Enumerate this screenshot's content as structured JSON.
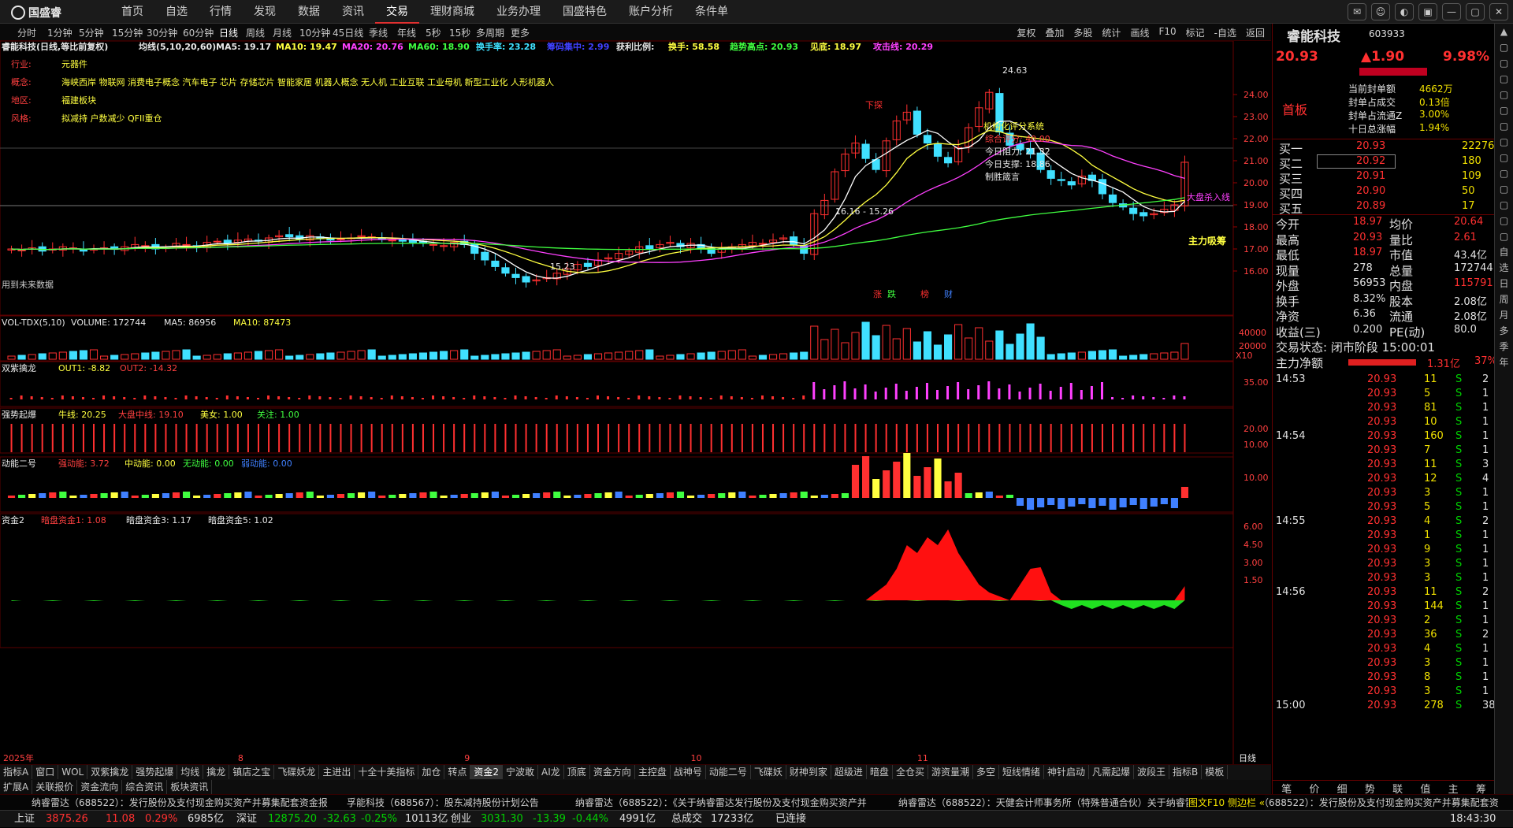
{
  "app": {
    "logo": "国盛睿"
  },
  "menu": [
    "首页",
    "自选",
    "行情",
    "发现",
    "数据",
    "资讯",
    "交易",
    "理财商城",
    "业务办理",
    "国盛特色",
    "账户分析",
    "条件单"
  ],
  "periods": [
    "分时",
    "1分钟",
    "5分钟",
    "15分钟",
    "30分钟",
    "60分钟",
    "日线",
    "周线",
    "月线",
    "10分钟",
    "45日线",
    "季线",
    "年线",
    "5秒",
    "15秒",
    "多周期",
    "更多"
  ],
  "right_tools": [
    "复权",
    "叠加",
    "多股",
    "统计",
    "画线",
    "F10",
    "标记",
    "-自选",
    "返回"
  ],
  "stock": {
    "name": "睿能科技",
    "code": "603933",
    "price": "20.93",
    "change": "▲1.90",
    "pct": "9.98%",
    "board": "首板"
  },
  "header_line": {
    "title": "睿能科技(日线,等比前复权)",
    "ma_label": "均线(5,10,20,60)",
    "ma5": "MA5: 19.17",
    "ma10": "MA10: 19.47",
    "ma20": "MA20: 20.76",
    "ma60": "MA60: 18.90",
    "turnover": "换手率: 23.28",
    "chip": "筹码集中: 2.99",
    "profit": "获利比例:",
    "hand": "换手: 58.58",
    "trend_high": "趋势高点: 20.93",
    "low": "见底: 18.97",
    "attack": "攻击线: 20.29"
  },
  "info": {
    "industry_label": "行业:",
    "industry": "元器件",
    "concept_label": "概念:",
    "concept": "海峡西岸 物联网 消费电子概念 汽车电子 芯片 存储芯片 智能家居 机器人概念 无人机 工业互联 工业母机 新型工业化 人形机器人",
    "region_label": "地区:",
    "region": "福建板块",
    "style_label": "风格:",
    "style": "拟减持 户数减少 QFII重仓"
  },
  "annotations": {
    "high": "24.63",
    "low1": "15.23",
    "lowpair": "16.16 - 15.26",
    "xiatan": "下探",
    "sys": "机构化评分系统",
    "score": "综合评分: 40.00",
    "pressure": "今日阻力: 21.32",
    "support": "今日支撑: 18.86",
    "win": "制胜箴言",
    "sell": "大盘杀入线",
    "main": "主力吸筹",
    "future": "用到未来数据",
    "zd": "涨",
    "die": "跌",
    "bang": "榜",
    "cai": "财"
  },
  "price_axis": [
    "24.00",
    "23.00",
    "22.00",
    "21.00",
    "20.00",
    "19.00",
    "18.00",
    "17.00",
    "16.00"
  ],
  "vol": {
    "title": "VOL-TDX(5,10)",
    "volume": "VOLUME: 172744",
    "ma5": "MA5: 86956",
    "ma10": "MA10: 87473",
    "axis": [
      "40000",
      "20000",
      "X10"
    ]
  },
  "ind1": {
    "title": "双紫擒龙",
    "out1": "OUT1: -8.82",
    "out2": "OUT2: -14.32",
    "axis": "35.00"
  },
  "ind2": {
    "title": "强势起爆",
    "niu": "牛线: 20.25",
    "dapan": "大盘中线: 19.10",
    "meinv": "美女: 1.00",
    "guanzhu": "关注: 1.00",
    "axis": [
      "20.00",
      "10.00"
    ]
  },
  "ind3": {
    "title": "动能二号",
    "strong": "强动能: 3.72",
    "mid": "中动能: 0.00",
    "none": "无动能: 0.00",
    "weak": "弱动能: 0.00",
    "axis": "10.00"
  },
  "ind4": {
    "title": "资金2",
    "a1": "暗盘资金1: 1.08",
    "a3": "暗盘资金3: 1.17",
    "a5": "暗盘资金5: 1.02",
    "axis": [
      "6.00",
      "4.50",
      "3.00",
      "1.50"
    ]
  },
  "xaxis": {
    "year": "2025年",
    "m8": "8",
    "m9": "9",
    "m10": "10",
    "m11": "11",
    "period": "日线"
  },
  "tabs1": [
    "指标A",
    "窗口",
    "WOL",
    "双紫擒龙",
    "强势起爆",
    "均线",
    "擒龙",
    "镇店之宝",
    "飞碟妖龙",
    "主进出",
    "十全十美指标",
    "加仓",
    "转点",
    "资金2",
    "宁波敢",
    "AI龙",
    "顶底",
    "资金方向",
    "主控盘",
    "战神号",
    "动能二号",
    "飞碟妖",
    "财神到家",
    "超级进",
    "暗盘",
    "全仓买",
    "游资量潮",
    "多空",
    "短线情绪",
    "神针启动",
    "凡需起爆",
    "波段王",
    "指标B",
    "模板"
  ],
  "tabs2": [
    "扩展A",
    "关联报价",
    "资金流向",
    "综合资讯",
    "板块资讯"
  ],
  "ticker": [
    "纳睿雷达（688522）：发行股份及支付现金购买资产并募集配套资金报",
    "孚能科技（688567）：股东减持股份计划公告",
    "纳睿雷达（688522）：《关于纳睿雷达发行股份及支付现金购买资产并",
    "纳睿雷达（688522）：天健会计师事务所（特殊普通合伙）关于纳睿雷",
    "纳睿雷达（688522）：发行股份及支付现金购买资产并募集配套资"
  ],
  "ticker_right": "图文F10 侧边栏 «",
  "quote": {
    "fengdan": [
      [
        "当前封单额",
        "4662万"
      ],
      [
        "封单占成交",
        "0.13倍"
      ],
      [
        "封单占流通Z",
        "3.00%"
      ],
      [
        "十日总涨幅",
        "1.94%"
      ]
    ],
    "sell": [
      [
        "买一",
        "20.93",
        "22276"
      ],
      [
        "买二",
        "20.92",
        "180"
      ],
      [
        "买三",
        "20.91",
        "109"
      ],
      [
        "买四",
        "20.90",
        "50"
      ],
      [
        "买五",
        "20.89",
        "17"
      ]
    ],
    "stats": [
      [
        "今开",
        "18.97",
        "均价",
        "20.64"
      ],
      [
        "最高",
        "20.93",
        "量比",
        "2.61"
      ],
      [
        "最低",
        "18.97",
        "市值",
        "43.4亿"
      ],
      [
        "现量",
        "278",
        "总量",
        "172744"
      ],
      [
        "外盘",
        "56953",
        "内盘",
        "115791"
      ],
      [
        "换手",
        "8.32%",
        "股本",
        "2.08亿"
      ],
      [
        "净资",
        "6.36",
        "流通",
        "2.08亿"
      ],
      [
        "收益(三)",
        "0.200",
        "PE(动)",
        "80.0"
      ]
    ],
    "trade_status": "交易状态: 闭市阶段 15:00:01",
    "net_label": "主力净额",
    "net_val": "1.31亿",
    "net_pct": "37%",
    "ticks": [
      [
        "14:53",
        "20.93",
        "11",
        "S",
        "2"
      ],
      [
        "",
        "20.93",
        "5",
        "S",
        "1"
      ],
      [
        "",
        "20.93",
        "81",
        "S",
        "1"
      ],
      [
        "",
        "20.93",
        "10",
        "S",
        "1"
      ],
      [
        "14:54",
        "20.93",
        "160",
        "S",
        "1"
      ],
      [
        "",
        "20.93",
        "7",
        "S",
        "1"
      ],
      [
        "",
        "20.93",
        "11",
        "S",
        "3"
      ],
      [
        "",
        "20.93",
        "12",
        "S",
        "4"
      ],
      [
        "",
        "20.93",
        "3",
        "S",
        "1"
      ],
      [
        "",
        "20.93",
        "5",
        "S",
        "1"
      ],
      [
        "14:55",
        "20.93",
        "4",
        "S",
        "2"
      ],
      [
        "",
        "20.93",
        "1",
        "S",
        "1"
      ],
      [
        "",
        "20.93",
        "9",
        "S",
        "1"
      ],
      [
        "",
        "20.93",
        "3",
        "S",
        "1"
      ],
      [
        "",
        "20.93",
        "3",
        "S",
        "1"
      ],
      [
        "14:56",
        "20.93",
        "11",
        "S",
        "2"
      ],
      [
        "",
        "20.93",
        "144",
        "S",
        "1"
      ],
      [
        "",
        "20.93",
        "2",
        "S",
        "1"
      ],
      [
        "",
        "20.93",
        "36",
        "S",
        "2"
      ],
      [
        "",
        "20.93",
        "4",
        "S",
        "1"
      ],
      [
        "",
        "20.93",
        "3",
        "S",
        "1"
      ],
      [
        "",
        "20.93",
        "8",
        "S",
        "1"
      ],
      [
        "",
        "20.93",
        "3",
        "S",
        "1"
      ],
      [
        "15:00",
        "20.93",
        "278",
        "S",
        "38"
      ]
    ],
    "btabs": [
      "笔",
      "价",
      "细",
      "势",
      "联",
      "值",
      "主",
      "筹"
    ]
  },
  "side": [
    "自",
    "选",
    "日",
    "周",
    "月",
    "多",
    "季",
    "年"
  ],
  "status": {
    "sh_label": "上证",
    "sh": "3875.26",
    "sh_ch": "11.08",
    "sh_pct": "0.29%",
    "sh_amt": "6985亿",
    "sz_label": "深证",
    "sz": "12875.20",
    "sz_ch": "-32.63",
    "sz_pct": "-0.25%",
    "sz_amt": "10113亿",
    "cy_label": "创业",
    "cy": "3031.30",
    "cy_ch": "-13.39",
    "cy_pct": "-0.44%",
    "cy_amt": "4991亿",
    "total_label": "总成交",
    "total": "17233亿",
    "conn": "已连接",
    "time": "18:43:30"
  },
  "chart_data": {
    "type": "candlestick",
    "title": "睿能科技(日线,等比前复权)",
    "closes": [
      17.0,
      16.95,
      17.05,
      16.9,
      17.0,
      17.1,
      17.05,
      16.9,
      17.0,
      17.05,
      16.98,
      17.1,
      17.2,
      17.15,
      17.0,
      17.05,
      17.25,
      17.2,
      17.1,
      17.3,
      17.35,
      17.25,
      17.4,
      17.45,
      17.35,
      17.5,
      17.6,
      17.55,
      17.45,
      17.6,
      17.5,
      17.4,
      17.45,
      17.5,
      17.6,
      17.55,
      17.45,
      17.4,
      17.35,
      17.3,
      17.25,
      17.2,
      17.15,
      17.3,
      17.2,
      16.8,
      16.5,
      16.2,
      15.9,
      15.7,
      15.5,
      15.6,
      15.7,
      15.9,
      16.1,
      16.3,
      16.2,
      16.5,
      16.6,
      16.8,
      16.9,
      17.1,
      17.0,
      17.2,
      17.3,
      17.1,
      17.25,
      17.0,
      16.8,
      17.0,
      17.1,
      17.2,
      17.3,
      17.25,
      17.4,
      17.5,
      17.2,
      16.8,
      18.6,
      19.2,
      20.5,
      21.3,
      21.8,
      21.1,
      20.6,
      21.9,
      22.8,
      23.2,
      22.2,
      21.8,
      21.2,
      20.9,
      21.6,
      22.5,
      23.4,
      24.1,
      22.3,
      21.7,
      21.5,
      21.3,
      20.6,
      20.2,
      20.1,
      19.9,
      20.3,
      20.1,
      19.5,
      19.1,
      18.9,
      18.6,
      18.5,
      18.6,
      18.8,
      19.0,
      20.93
    ],
    "ma5": "19.17",
    "ma10": "19.47",
    "ma20": "20.76",
    "ma60": "18.90",
    "high_mark": "24.63",
    "low_mark": "15.23",
    "x_months": [
      "8",
      "9",
      "10",
      "11"
    ]
  }
}
